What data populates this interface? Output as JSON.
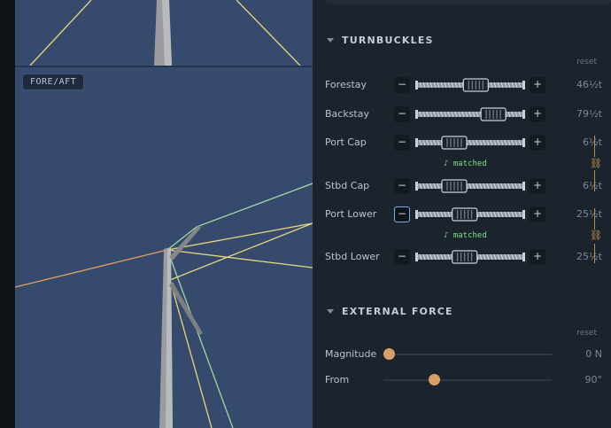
{
  "viewport": {
    "main_label": "FORE/AFT"
  },
  "turnbuckles": {
    "title": "TURNBUCKLES",
    "reset_label": "reset",
    "minus_label": "−",
    "plus_label": "+",
    "rows": [
      {
        "label": "Forestay",
        "value": "46½t",
        "position": 0.57
      },
      {
        "label": "Backstay",
        "value": "79½t",
        "position": 0.79
      },
      {
        "label": "Port Cap",
        "value": "6½t",
        "position": 0.3
      },
      {
        "label": "Stbd Cap",
        "value": "6½t",
        "position": 0.3
      },
      {
        "label": "Port Lower",
        "value": "25½t",
        "position": 0.43
      },
      {
        "label": "Stbd Lower",
        "value": "25½t",
        "position": 0.43
      }
    ],
    "matched_label": "♪ matched"
  },
  "external_force": {
    "title": "EXTERNAL FORCE",
    "reset_label": "reset",
    "magnitude": {
      "label": "Magnitude",
      "value": "0 N",
      "fraction": 0.0
    },
    "from": {
      "label": "From",
      "value": "90°",
      "fraction": 0.27
    }
  },
  "icons": {
    "collapse": "chevron-down-icon",
    "link": "chain-link-icon"
  },
  "colors": {
    "viewport_bg": "#364a6d",
    "panel_bg": "#1b232c",
    "matched": "#7ee08a",
    "accent": "#d9a066",
    "stay_yellow": "#e8d77a",
    "stay_green": "#9fd9a0",
    "stay_orange": "#e8a05a"
  }
}
